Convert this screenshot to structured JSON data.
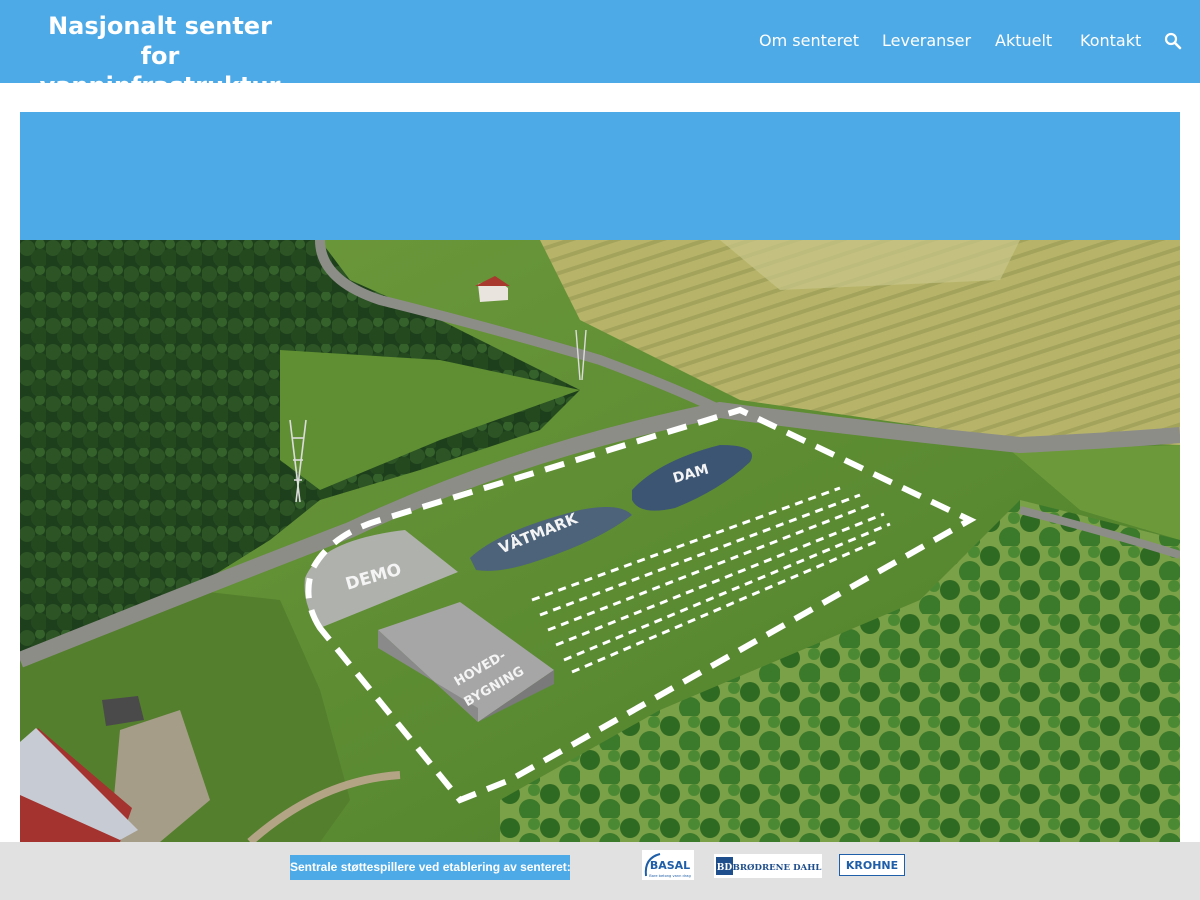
{
  "site": {
    "title_line1": "Nasjonalt senter for",
    "title_line2": "vanninfrastruktur",
    "brand_color": "#4eaae6"
  },
  "nav": {
    "items": [
      {
        "label": "Om senteret"
      },
      {
        "label": "Leveranser"
      },
      {
        "label": "Aktuelt"
      },
      {
        "label": "Kontakt"
      }
    ],
    "search_icon": "search-icon"
  },
  "hero": {
    "zones": {
      "demo": "DEMO",
      "vatmark": "VÅTMARK",
      "dam": "DAM",
      "hoved_line1": "HOVED-",
      "hoved_line2": "BYGNING"
    }
  },
  "footer": {
    "sponsor_label": "Sentrale støttespillere ved etablering av senteret:",
    "logos": {
      "basal_name": "BASAL",
      "basal_tagline": "Bare betong vann drag",
      "dahl_name": "BRØDRENE DAHL",
      "krohne_name": "KROHNE"
    }
  }
}
